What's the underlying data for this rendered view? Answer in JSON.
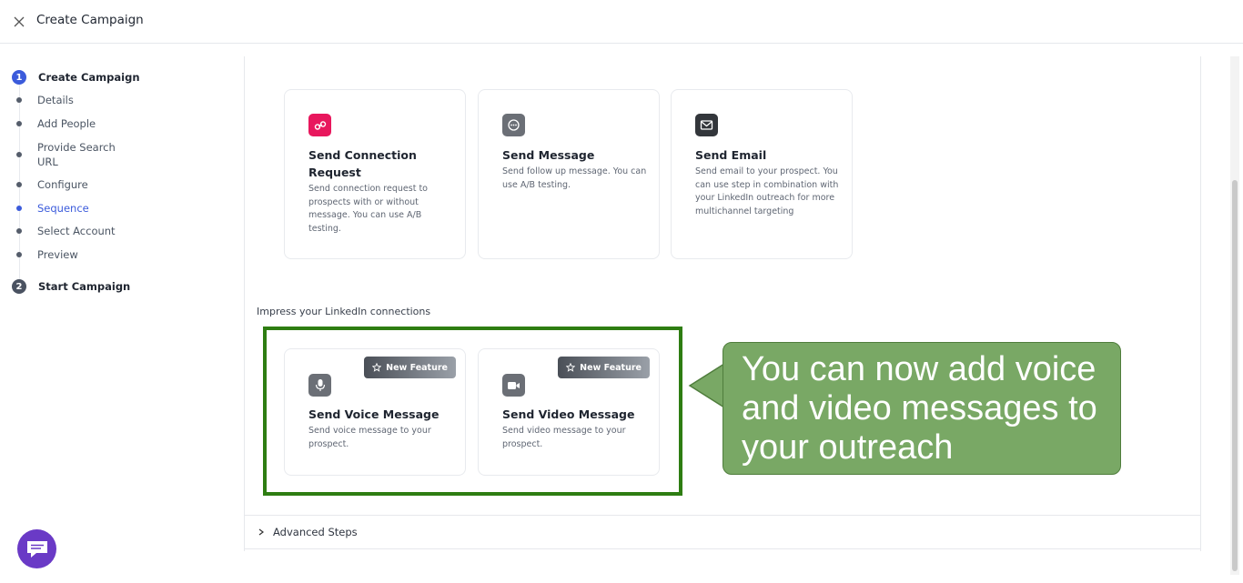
{
  "header": {
    "title": "Create Campaign"
  },
  "stepper": {
    "step1": {
      "number": "1",
      "label": "Create Campaign"
    },
    "substeps": [
      "Details",
      "Add People",
      "Provide Search URL",
      "Configure",
      "Sequence",
      "Select Account",
      "Preview"
    ],
    "active_substep": "Sequence",
    "step2": {
      "number": "2",
      "label": "Start Campaign"
    }
  },
  "cards_top": [
    {
      "title": "Send Connection Request",
      "desc": "Send connection request to prospects with or without message. You can use A/B testing.",
      "icon": "link-icon",
      "icon_color": "#e8175d"
    },
    {
      "title": "Send Message",
      "desc": "Send follow up message. You can use A/B testing.",
      "icon": "chat-bubble-icon",
      "icon_color": "#6b6f76"
    },
    {
      "title": "Send Email",
      "desc": "Send email to your prospect. You can use step in combination with your LinkedIn outreach for more multichannel targeting",
      "icon": "mail-icon",
      "icon_color": "#33363b"
    }
  ],
  "section": {
    "label": "Impress your LinkedIn connections"
  },
  "cards_bottom": [
    {
      "title": "Send Voice Message",
      "desc": "Send voice message to your prospect.",
      "badge": "New Feature",
      "icon": "microphone-icon",
      "icon_color": "#6b6f76"
    },
    {
      "title": "Send Video Message",
      "desc": "Send video message to your prospect.",
      "badge": "New Feature",
      "icon": "video-camera-icon",
      "icon_color": "#6b6f76"
    }
  ],
  "callout": {
    "text": "You can now add voice and video messages to your outreach"
  },
  "advanced": {
    "label": "Advanced Steps"
  },
  "colors": {
    "accent": "#3b5bdb",
    "highlight": "#2e7d12",
    "callout_bg": "#79a865",
    "chat_button": "#6a3ac6"
  }
}
